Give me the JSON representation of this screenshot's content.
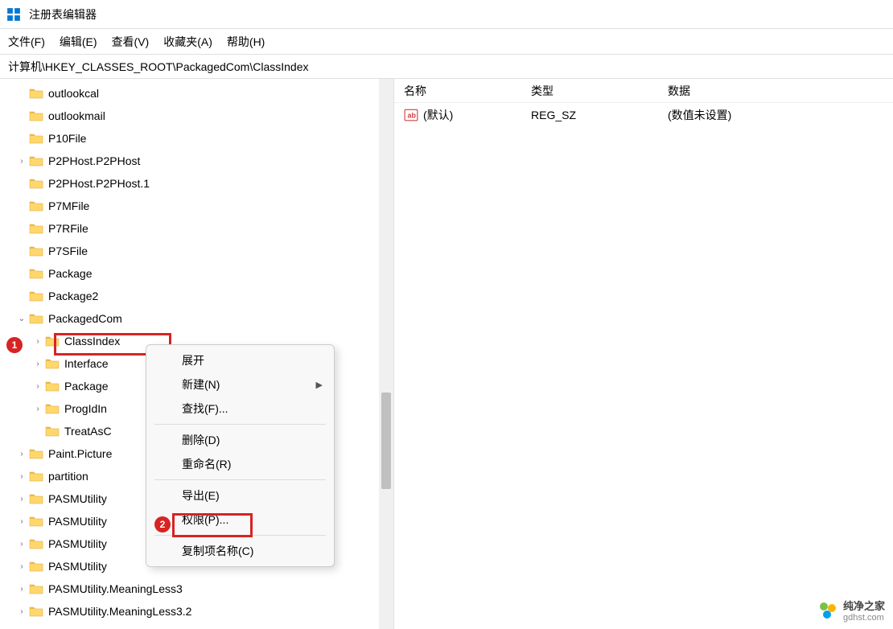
{
  "titlebar": {
    "title": "注册表编辑器"
  },
  "menubar": {
    "file": "文件(F)",
    "edit": "编辑(E)",
    "view": "查看(V)",
    "favorites": "收藏夹(A)",
    "help": "帮助(H)"
  },
  "addressbar": {
    "path": "计算机\\HKEY_CLASSES_ROOT\\PackagedCom\\ClassIndex"
  },
  "tree": {
    "items": [
      {
        "label": "outlookcal",
        "depth": 1,
        "expandable": false
      },
      {
        "label": "outlookmail",
        "depth": 1,
        "expandable": false
      },
      {
        "label": "P10File",
        "depth": 1,
        "expandable": false
      },
      {
        "label": "P2PHost.P2PHost",
        "depth": 1,
        "expandable": true
      },
      {
        "label": "P2PHost.P2PHost.1",
        "depth": 1,
        "expandable": false
      },
      {
        "label": "P7MFile",
        "depth": 1,
        "expandable": false
      },
      {
        "label": "P7RFile",
        "depth": 1,
        "expandable": false
      },
      {
        "label": "P7SFile",
        "depth": 1,
        "expandable": false
      },
      {
        "label": "Package",
        "depth": 1,
        "expandable": false
      },
      {
        "label": "Package2",
        "depth": 1,
        "expandable": false
      },
      {
        "label": "PackagedCom",
        "depth": 1,
        "expandable": true,
        "expanded": true
      },
      {
        "label": "ClassIndex",
        "depth": 2,
        "expandable": true,
        "selected": true
      },
      {
        "label": "Interface",
        "depth": 2,
        "expandable": true
      },
      {
        "label": "Package",
        "depth": 2,
        "expandable": true
      },
      {
        "label": "ProgIdIn",
        "depth": 2,
        "expandable": true
      },
      {
        "label": "TreatAsC",
        "depth": 2,
        "expandable": false
      },
      {
        "label": "Paint.Picture",
        "depth": 1,
        "expandable": true
      },
      {
        "label": "partition",
        "depth": 1,
        "expandable": true
      },
      {
        "label": "PASMUtility",
        "depth": 1,
        "expandable": true
      },
      {
        "label": "PASMUtility",
        "depth": 1,
        "expandable": true
      },
      {
        "label": "PASMUtility",
        "depth": 1,
        "expandable": true
      },
      {
        "label": "PASMUtility",
        "depth": 1,
        "expandable": true
      },
      {
        "label": "PASMUtility.MeaningLess3",
        "depth": 1,
        "expandable": true
      },
      {
        "label": "PASMUtility.MeaningLess3.2",
        "depth": 1,
        "expandable": true
      }
    ]
  },
  "list": {
    "headers": {
      "name": "名称",
      "type": "类型",
      "data": "数据"
    },
    "rows": [
      {
        "name": "(默认)",
        "type": "REG_SZ",
        "data": "(数值未设置)"
      }
    ]
  },
  "context_menu": {
    "expand": "展开",
    "new": "新建(N)",
    "find": "查找(F)...",
    "delete": "删除(D)",
    "rename": "重命名(R)",
    "export": "导出(E)",
    "permissions": "权限(P)...",
    "copy_key_name": "复制项名称(C)"
  },
  "markers": {
    "m1": "1",
    "m2": "2"
  },
  "watermark": {
    "name": "纯净之家",
    "url": "gdhst.com"
  }
}
